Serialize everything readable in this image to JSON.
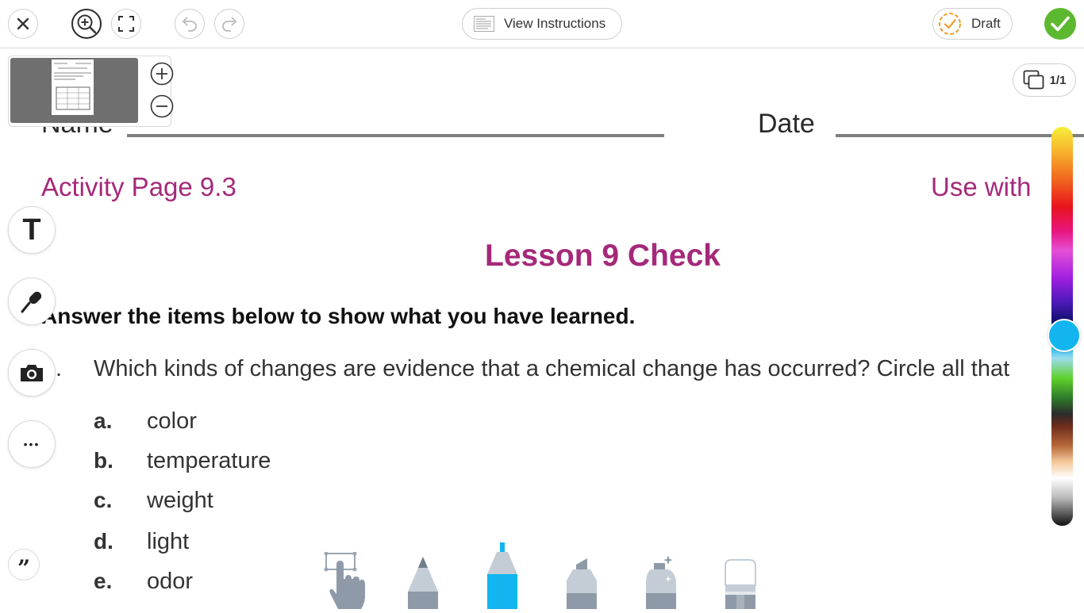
{
  "toolbar": {
    "view_instructions_label": "View Instructions",
    "draft_label": "Draft",
    "page_indicator": "1/1"
  },
  "worksheet": {
    "name_label": "Name",
    "date_label": "Date",
    "activity_page": "Activity Page 9.3",
    "use_with": "Use with",
    "title": "Lesson 9 Check",
    "instructions": "Answer the items below to show what you have learned.",
    "question_number": ".",
    "question": "Which kinds of changes are evidence that a chemical change has occurred? Circle all that",
    "options": [
      {
        "letter": "a.",
        "text": "color"
      },
      {
        "letter": "b.",
        "text": "temperature"
      },
      {
        "letter": "c.",
        "text": "weight"
      },
      {
        "letter": "d.",
        "text": "light"
      },
      {
        "letter": "e.",
        "text": "odor"
      }
    ]
  },
  "left_tools": {
    "text_tool_glyph": "T",
    "more_glyph": "•••",
    "quote_glyph": "”"
  },
  "colors": {
    "accent_magenta": "#a5297a",
    "selected_color": "#12b5f0",
    "done_green": "#5cb82e",
    "draft_orange": "#f39c2a"
  },
  "icons": [
    "close-icon",
    "zoom-in-icon",
    "fullscreen-icon",
    "undo-icon",
    "redo-icon",
    "checkmark-icon",
    "plus-icon",
    "minus-icon",
    "pages-icon",
    "microphone-icon",
    "camera-icon",
    "quote-icon",
    "select-hand-icon",
    "pencil-icon",
    "marker-icon",
    "highlighter-icon",
    "spray-icon",
    "eraser-icon"
  ]
}
